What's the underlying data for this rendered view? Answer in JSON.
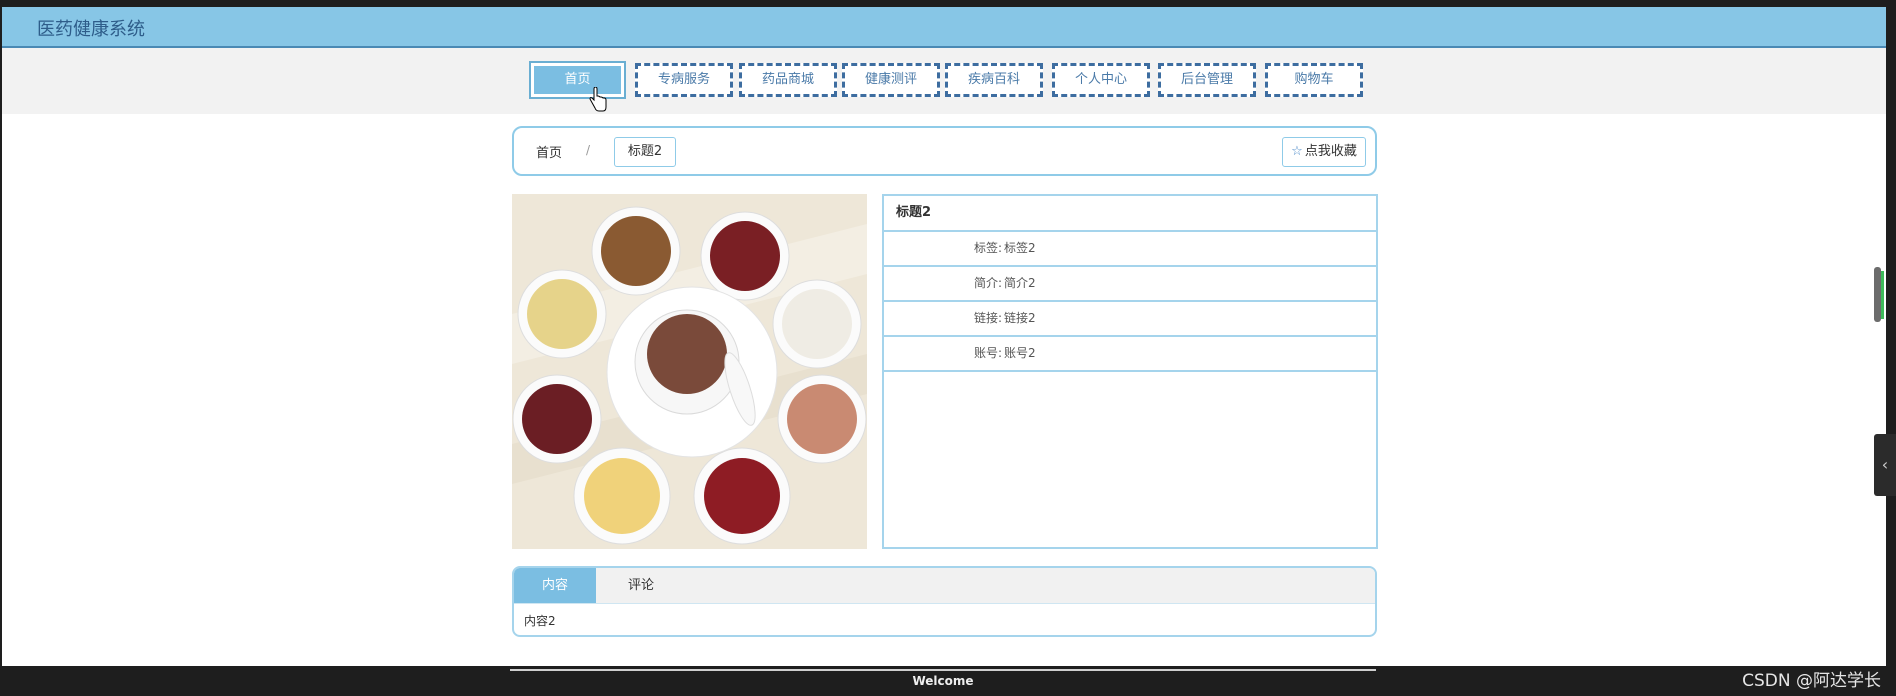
{
  "header": {
    "site_title": "医药健康系统",
    "brand_color": "#87c6e6"
  },
  "nav": {
    "items": [
      {
        "label": "首页",
        "active": true
      },
      {
        "label": "专病服务"
      },
      {
        "label": "药品商城"
      },
      {
        "label": "健康测评"
      },
      {
        "label": "疾病百科"
      },
      {
        "label": "个人中心"
      },
      {
        "label": "后台管理"
      },
      {
        "label": "购物车"
      }
    ]
  },
  "breadcrumb": {
    "home": "首页",
    "separator": "/",
    "current": "标题2"
  },
  "actions": {
    "favorite_label": "点我收藏",
    "favorite_icon": "star-icon"
  },
  "detail": {
    "title": "标题2",
    "rows": [
      {
        "label": "标签:",
        "value": "标签2"
      },
      {
        "label": "简介:",
        "value": "简介2"
      },
      {
        "label": "链接:",
        "value": "链接2"
      },
      {
        "label": "账号:",
        "value": "账号2"
      }
    ]
  },
  "tabs": {
    "items": [
      {
        "label": "内容",
        "active": true
      },
      {
        "label": "评论"
      }
    ],
    "content_text": "内容2"
  },
  "footer": {
    "text": "Welcome"
  },
  "watermark": "CSDN @阿达学长"
}
